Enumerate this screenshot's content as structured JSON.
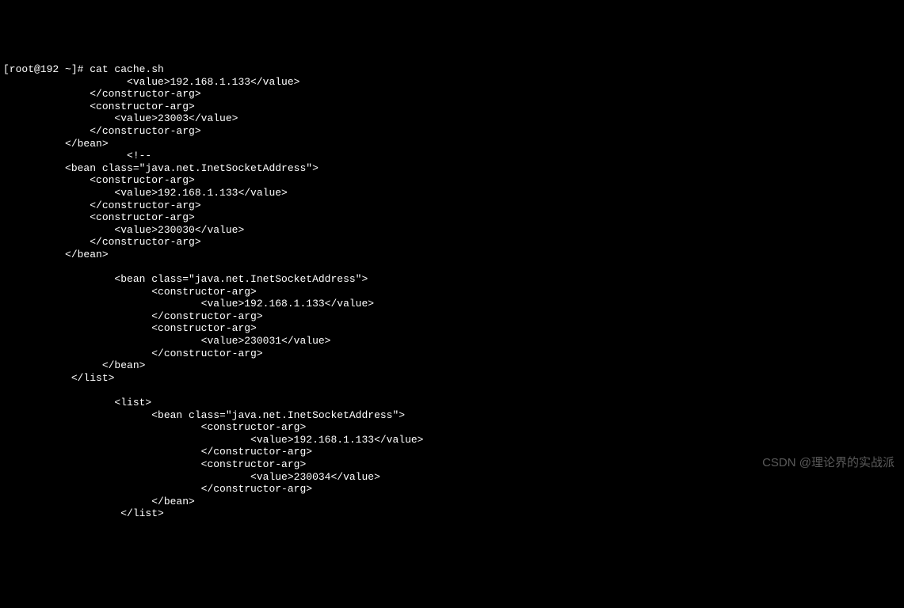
{
  "prompt": "[root@192 ~]# cat cache.sh",
  "lines": [
    "                    <value>192.168.1.133</value>",
    "              </constructor-arg>",
    "              <constructor-arg>",
    "                  <value>23003</value>",
    "              </constructor-arg>",
    "          </bean>",
    "                    <!--",
    "          <bean class=\"java.net.InetSocketAddress\">",
    "              <constructor-arg>",
    "                  <value>192.168.1.133</value>",
    "              </constructor-arg>",
    "              <constructor-arg>",
    "                  <value>230030</value>",
    "              </constructor-arg>",
    "          </bean>",
    "",
    "                  <bean class=\"java.net.InetSocketAddress\">",
    "                        <constructor-arg>",
    "                                <value>192.168.1.133</value>",
    "                        </constructor-arg>",
    "                        <constructor-arg>",
    "                                <value>230031</value>",
    "                        </constructor-arg>",
    "                </bean>",
    "           </list>",
    "",
    "                  <list>",
    "                        <bean class=\"java.net.InetSocketAddress\">",
    "                                <constructor-arg>",
    "                                        <value>192.168.1.133</value>",
    "                                </constructor-arg>",
    "                                <constructor-arg>",
    "                                        <value>230034</value>",
    "                                </constructor-arg>",
    "                        </bean>",
    "                   </list>"
  ],
  "watermark": "CSDN @理论界的实战派"
}
